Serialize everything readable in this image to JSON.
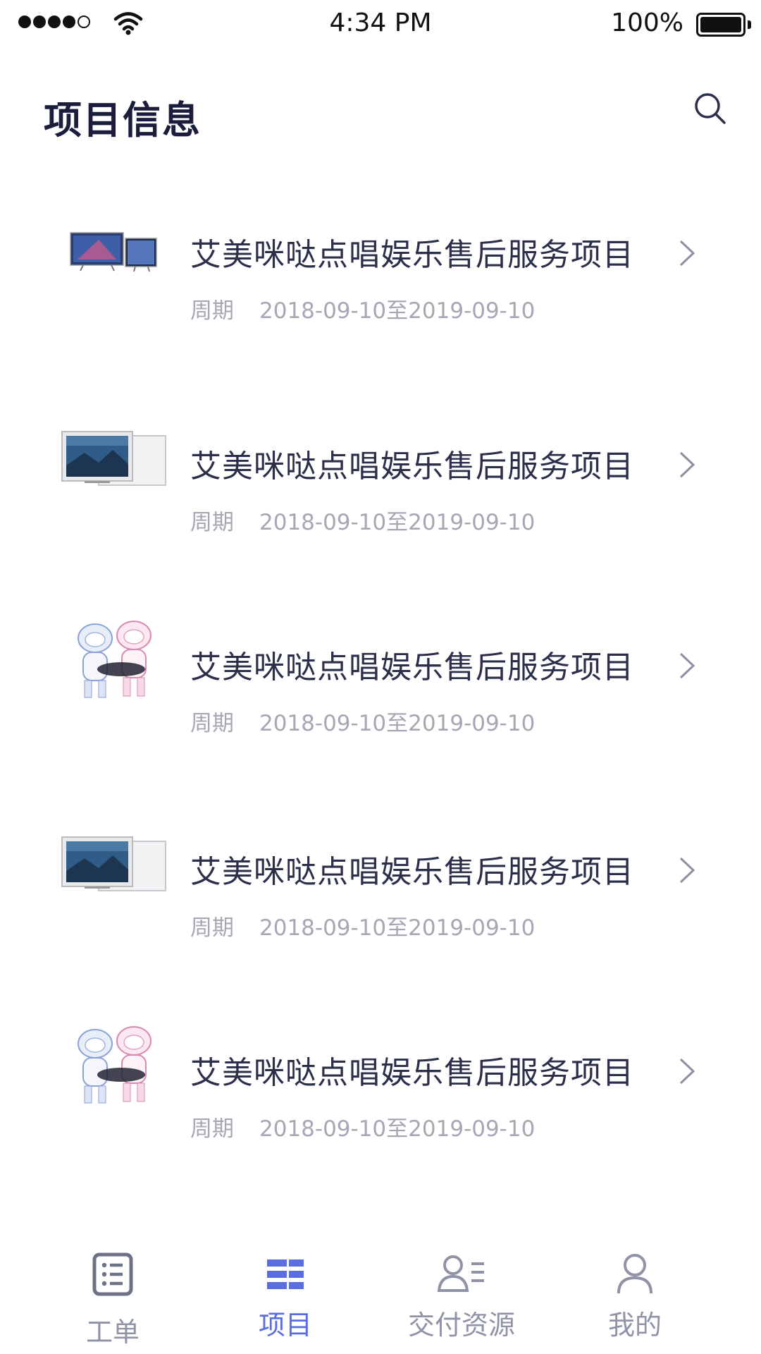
{
  "status_bar": {
    "time": "4:34 PM",
    "battery": "100%"
  },
  "header": {
    "title": "项目信息",
    "search_icon": "search-icon"
  },
  "projects": [
    {
      "title": "艾美咪哒点唱娱乐售后服务项目",
      "period_label": "周期",
      "period": "2018-09-10至2019-09-10",
      "thumbnail": "tv-product"
    },
    {
      "title": "艾美咪哒点唱娱乐售后服务项目",
      "period_label": "周期",
      "period": "2018-09-10至2019-09-10",
      "thumbnail": "tv-monitor"
    },
    {
      "title": "艾美咪哒点唱娱乐售后服务项目",
      "period_label": "周期",
      "period": "2018-09-10至2019-09-10",
      "thumbnail": "robot-pair"
    },
    {
      "title": "艾美咪哒点唱娱乐售后服务项目",
      "period_label": "周期",
      "period": "2018-09-10至2019-09-10",
      "thumbnail": "tv-monitor"
    },
    {
      "title": "艾美咪哒点唱娱乐售后服务项目",
      "period_label": "周期",
      "period": "2018-09-10至2019-09-10",
      "thumbnail": "robot-pair"
    }
  ],
  "tabs": [
    {
      "label": "工单",
      "icon": "list-doc-icon",
      "active": false
    },
    {
      "label": "项目",
      "icon": "stack-icon",
      "active": true
    },
    {
      "label": "交付资源",
      "icon": "user-list-icon",
      "active": false
    },
    {
      "label": "我的",
      "icon": "user-icon",
      "active": false
    }
  ],
  "colors": {
    "accent": "#5b6ee1",
    "title": "#1b1d3d",
    "text": "#2b2f4a",
    "muted": "#a5a8b3",
    "tab_inactive": "#8f93a5"
  }
}
